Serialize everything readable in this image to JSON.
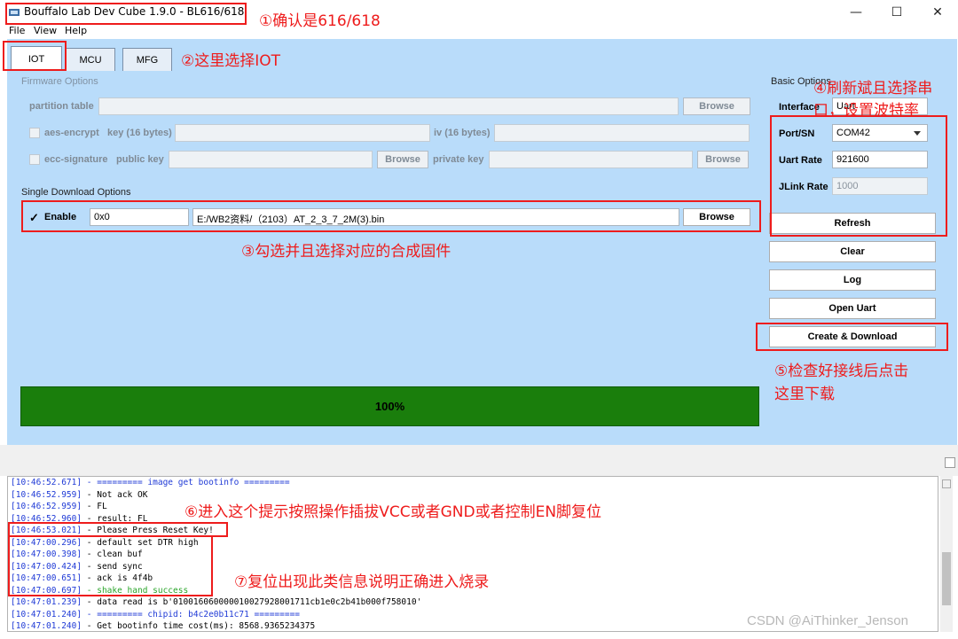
{
  "window": {
    "title": "Bouffalo Lab Dev Cube 1.9.0 - BL616/618",
    "minimize": "—",
    "maximize": "☐",
    "close": "✕"
  },
  "menu": [
    "File",
    "View",
    "Help"
  ],
  "tabs": [
    "IOT",
    "MCU",
    "MFG"
  ],
  "firmware": {
    "group_title": "Firmware Options",
    "partition_table": "partition table",
    "aes_encrypt": "aes-encrypt",
    "key": "key (16 bytes)",
    "iv": "iv (16 bytes)",
    "ecc_signature": "ecc-signature",
    "public_key": "public key",
    "private_key": "private key",
    "browse": "Browse"
  },
  "single": {
    "group_title": "Single Download Options",
    "enable_label": "Enable",
    "checkmark": "✓",
    "address": "0x0",
    "path": "E:/WB2资料/（2103）AT_2_3_7_2M(3).bin",
    "browse": "Browse"
  },
  "basic": {
    "group_title": "Basic Options",
    "interface_label": "Interface",
    "interface_value": "Uart",
    "port_label": "Port/SN",
    "port_value": "COM42",
    "uart_rate_label": "Uart Rate",
    "uart_rate_value": "921600",
    "jlink_rate_label": "JLink Rate",
    "jlink_rate_value": "1000"
  },
  "buttons": {
    "refresh": "Refresh",
    "clear": "Clear",
    "log": "Log",
    "open_uart": "Open Uart",
    "create_download": "Create & Download"
  },
  "progress": {
    "value": 1.0,
    "label": "100%",
    "color": "#1a7e0c"
  },
  "log": [
    {
      "time": "[10:46:52.671]",
      "text": " - ========= image get bootinfo =========",
      "color": "#1f3ad6"
    },
    {
      "time": "[10:46:52.959]",
      "text": " - Not ack OK",
      "color": "#000000"
    },
    {
      "time": "[10:46:52.959]",
      "text": " - FL",
      "color": "#000000"
    },
    {
      "time": "[10:46:52.960]",
      "text": " - result: FL",
      "color": "#000000"
    },
    {
      "time": "[10:46:53.021]",
      "text": " - Please Press Reset Key!",
      "color": "#000000"
    },
    {
      "time": "[10:47:00.296]",
      "text": " - default set DTR high",
      "color": "#000000"
    },
    {
      "time": "[10:47:00.398]",
      "text": " - clean buf",
      "color": "#000000"
    },
    {
      "time": "[10:47:00.424]",
      "text": " - send sync",
      "color": "#000000"
    },
    {
      "time": "[10:47:00.651]",
      "text": " - ack is 4f4b",
      "color": "#000000"
    },
    {
      "time": "[10:47:00.697]",
      "text": " - shake hand success",
      "color": "#2aa52a"
    },
    {
      "time": "[10:47:01.239]",
      "text": " - data read is b'010016060000010027928001711cb1e0c2b41b000f758010'",
      "color": "#000000"
    },
    {
      "time": "[10:47:01.240]",
      "text": " - ========= chipid: b4c2e0b11c71 =========",
      "color": "#1f3ad6"
    },
    {
      "time": "[10:47:01.240]",
      "text": " - Get bootinfo time cost(ms): 8568.9365234375",
      "color": "#000000"
    }
  ],
  "annotations": {
    "a1": "①确认是616/618",
    "a2": "②这里选择IOT",
    "a3": "③勾选并且选择对应的合成固件",
    "a4_line1": "④刷新斌且选择串",
    "a4_line2": "口，设置波特率",
    "a5_line1": "⑤检查好接线后点击",
    "a5_line2": "这里下载",
    "a6": "⑥进入这个提示按照操作插拔VCC或者GND或者控制EN脚复位",
    "a7": "⑦复位出现此类信息说明正确进入烧录"
  },
  "watermark": "CSDN @AiThinker_Jenson"
}
